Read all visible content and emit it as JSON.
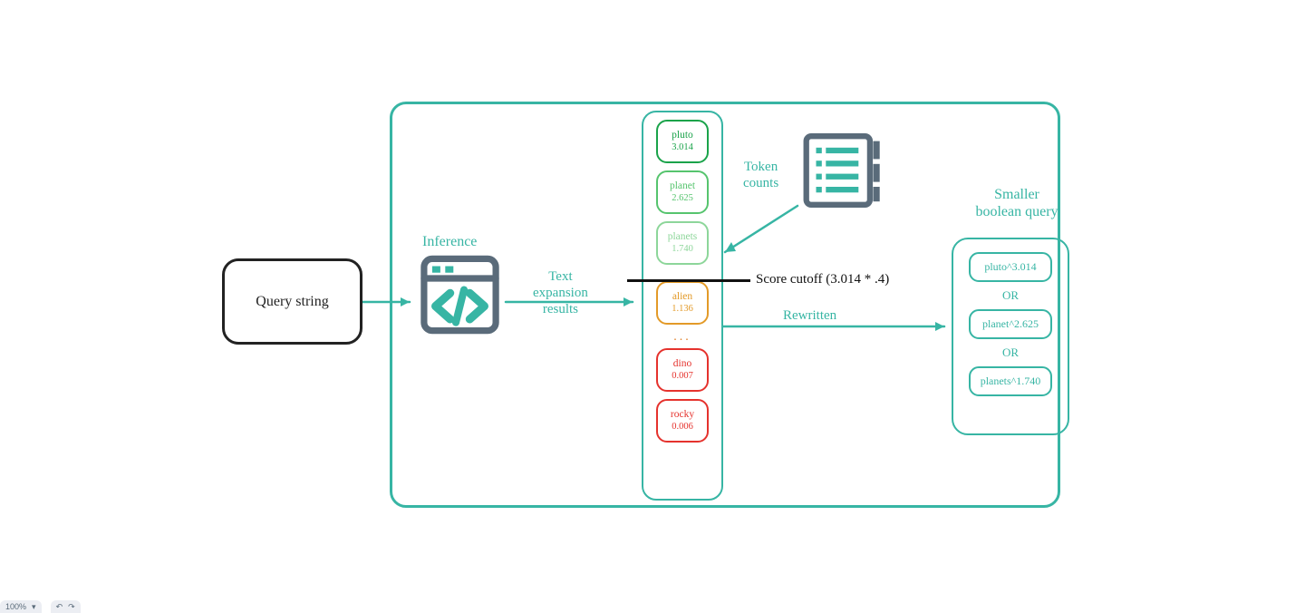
{
  "query_label": "Query string",
  "inference_label": "Inference",
  "text_expansion_label": "Text\nexpansion\nresults",
  "tokens": [
    {
      "name": "pluto",
      "value": "3.014",
      "color": "#1aa34a"
    },
    {
      "name": "planet",
      "value": "2.625",
      "color": "#56c46e"
    },
    {
      "name": "planets",
      "value": "1.740",
      "color": "#8dd69a"
    },
    {
      "name": "alien",
      "value": "1.136",
      "color": "#e39a28"
    },
    {
      "name": "dino",
      "value": "0.007",
      "color": "#e5322d"
    },
    {
      "name": "rocky",
      "value": "0.006",
      "color": "#e5322d"
    }
  ],
  "dots": "...",
  "cutoff_label": "Score cutoff (3.014 * .4)",
  "token_counts_label": "Token\ncounts",
  "rewritten_label": "Rewritten",
  "smaller_query_label": "Smaller\nboolean query",
  "bool_terms": [
    "pluto^3.014",
    "planet^2.625",
    "planets^1.740"
  ],
  "bool_or": "OR",
  "colors": {
    "accent": "#37b5a4",
    "dark": "#5a6b7a"
  },
  "toolbar": {
    "zoom": "100%",
    "undo": "↶",
    "redo": "↷"
  }
}
